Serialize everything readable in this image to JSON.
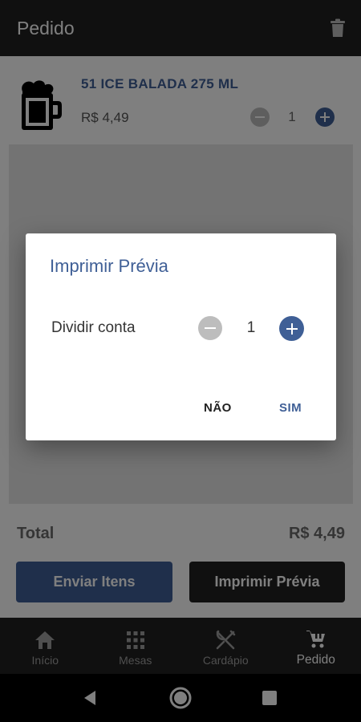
{
  "app_bar": {
    "title": "Pedido",
    "action_icon": "trash-icon"
  },
  "order": {
    "items": [
      {
        "name": "51 ICE BALADA 275 ML",
        "price": "R$ 4,49",
        "quantity": "1",
        "icon": "beer-mug-icon"
      }
    ],
    "total_label": "Total",
    "total_value": "R$ 4,49"
  },
  "actions": {
    "send_label": "Enviar Itens",
    "print_label": "Imprimir Prévia"
  },
  "bottom_nav": {
    "items": [
      {
        "label": "Início",
        "icon": "home-icon",
        "active": false
      },
      {
        "label": "Mesas",
        "icon": "grid-icon",
        "active": false
      },
      {
        "label": "Cardápio",
        "icon": "utensils-icon",
        "active": false
      },
      {
        "label": "Pedido",
        "icon": "cart-icon",
        "active": true
      }
    ]
  },
  "dialog": {
    "title": "Imprimir Prévia",
    "split_label": "Dividir conta",
    "split_value": "1",
    "cancel_label": "NÃO",
    "confirm_label": "SIM"
  },
  "colors": {
    "accent": "#3f5f96",
    "dark": "#212121",
    "disabled": "#bdbdbd"
  }
}
